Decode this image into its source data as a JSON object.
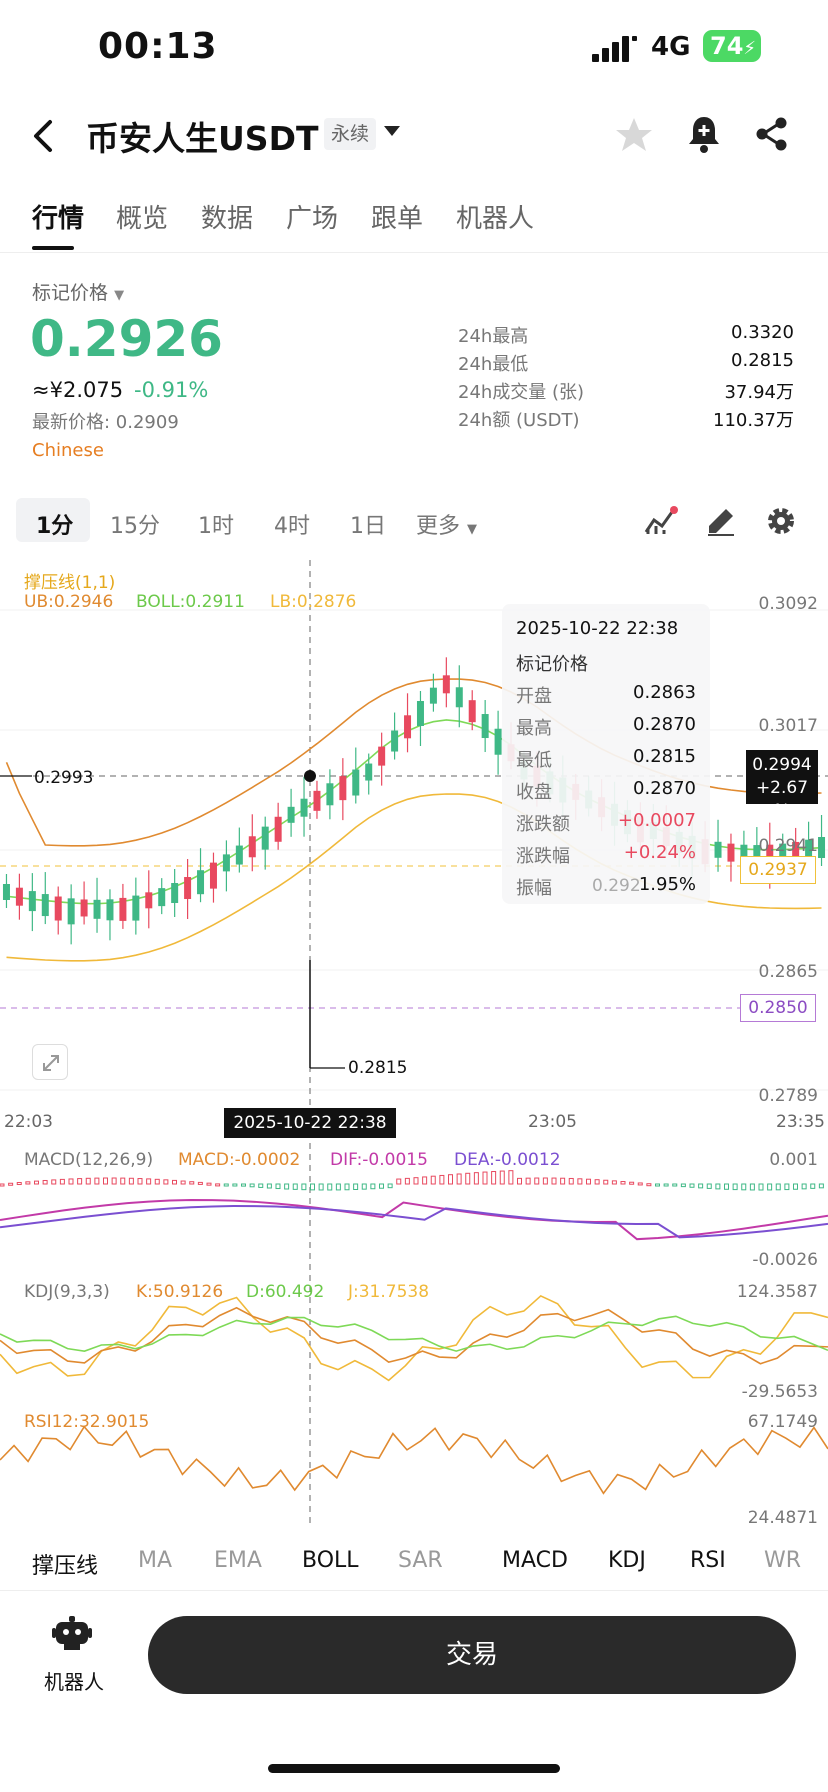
{
  "status": {
    "time": "00:13",
    "network": "4G",
    "battery": "74"
  },
  "header": {
    "title": "币安人生USDT",
    "perp_tag": "永续"
  },
  "tabs": [
    "行情",
    "概览",
    "数据",
    "广场",
    "跟单",
    "机器人"
  ],
  "price": {
    "mark_label": "标记价格",
    "mark_price": "0.2926",
    "cny": "≈¥2.075",
    "change": "-0.91%",
    "last_price": "最新价格: 0.2909",
    "language": "Chinese"
  },
  "stats": [
    {
      "label": "24h最高",
      "value": "0.3320"
    },
    {
      "label": "24h最低",
      "value": "0.2815"
    },
    {
      "label": "24h成交量 (张)",
      "value": "37.94万"
    },
    {
      "label": "24h额 (USDT)",
      "value": "110.37万"
    }
  ],
  "intervals": [
    "1分",
    "15分",
    "1时",
    "4时",
    "1日",
    "更多"
  ],
  "chart": {
    "legend_title": "撑压线(1,1)",
    "ub": "UB:0.2946",
    "boll": "BOLL:0.2911",
    "lb": "LB:0.2876",
    "price_axis": [
      "0.3092",
      "0.3017",
      "0.2941",
      "0.2865",
      "0.2789"
    ],
    "time_axis": [
      "22:03",
      "23:05",
      "23:35"
    ],
    "hi_mark": "0.2993",
    "lo_mark": "0.2815",
    "tag_cross": "0.2994",
    "tag_cross_pct": "+2.67 %",
    "tag_gold": "0.2937",
    "tag_purple": "0.2850",
    "crosshair_time": "2025-10-22 22:38",
    "ghost_price": "0.292",
    "tooltip": {
      "time": "2025-10-22 22:38",
      "title": "标记价格",
      "rows": [
        {
          "label": "开盘",
          "value": "0.2863",
          "color": "#111111"
        },
        {
          "label": "最高",
          "value": "0.2870",
          "color": "#111111"
        },
        {
          "label": "最低",
          "value": "0.2815",
          "color": "#111111"
        },
        {
          "label": "收盘",
          "value": "0.2870",
          "color": "#111111"
        },
        {
          "label": "涨跌额",
          "value": "+0.0007",
          "color": "#e8495f"
        },
        {
          "label": "涨跌幅",
          "value": "+0.24%",
          "color": "#e8495f"
        },
        {
          "label": "振幅",
          "value": "1.95%",
          "color": "#111111"
        }
      ]
    },
    "macd": {
      "title": "MACD(12,26,9)",
      "macd": "MACD:-0.0002",
      "dif": "DIF:-0.0015",
      "dea": "DEA:-0.0012",
      "axis_top": "0.001",
      "axis_bottom": "-0.0026"
    },
    "kdj": {
      "title": "KDJ(9,3,3)",
      "k": "K:50.9126",
      "d": "D:60.492",
      "j": "J:31.7538",
      "axis_top": "124.3587",
      "axis_bottom": "-29.5653"
    },
    "rsi": {
      "title": "RSI12:32.9015",
      "axis_top": "67.1749",
      "axis_bottom": "24.4871"
    }
  },
  "indicator_tabs": [
    {
      "label": "撑压线",
      "on": true
    },
    {
      "label": "MA",
      "on": false
    },
    {
      "label": "EMA",
      "on": false
    },
    {
      "label": "BOLL",
      "on": true
    },
    {
      "label": "SAR",
      "on": false
    },
    {
      "label": "MACD",
      "on": true
    },
    {
      "label": "KDJ",
      "on": true
    },
    {
      "label": "RSI",
      "on": true
    },
    {
      "label": "WR",
      "on": false
    }
  ],
  "bottom": {
    "robot_label": "机器人",
    "trade_label": "交易"
  },
  "colors": {
    "up": "#e8495f",
    "down": "#3fb886",
    "ub": "#e08a30",
    "boll": "#7ed957",
    "lb": "#f0b93a",
    "dif": "#c23aa8",
    "dea": "#7b4fd1"
  }
}
